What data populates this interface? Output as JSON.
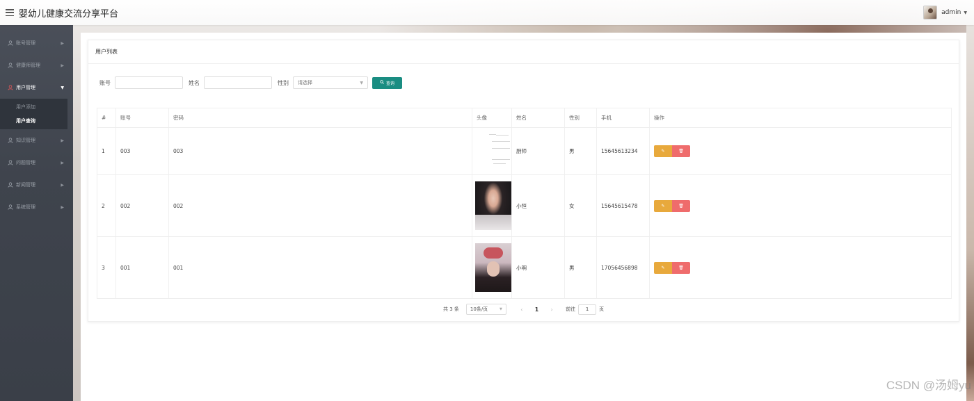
{
  "app": {
    "title": "婴幼儿健康交流分享平台"
  },
  "user": {
    "name": "admin"
  },
  "sidebar": {
    "items": [
      {
        "label": "账号管理"
      },
      {
        "label": "健康师管理"
      },
      {
        "label": "用户管理",
        "children": [
          {
            "label": "用户添加"
          },
          {
            "label": "用户查询"
          }
        ]
      },
      {
        "label": "知识管理"
      },
      {
        "label": "问题管理"
      },
      {
        "label": "新闻管理"
      },
      {
        "label": "系统管理"
      }
    ]
  },
  "card": {
    "title": "用户列表"
  },
  "filters": {
    "account_label": "账号",
    "name_label": "姓名",
    "gender_label": "性别",
    "gender_placeholder": "请选择",
    "query_button": "查询"
  },
  "table": {
    "headers": [
      "#",
      "账号",
      "密码",
      "头像",
      "姓名",
      "性别",
      "手机",
      "操作"
    ],
    "rows": [
      {
        "index": "1",
        "account": "003",
        "password": "003",
        "name": "厨师",
        "gender": "男",
        "phone": "15645613234"
      },
      {
        "index": "2",
        "account": "002",
        "password": "002",
        "name": "小恒",
        "gender": "女",
        "phone": "15645615478"
      },
      {
        "index": "3",
        "account": "001",
        "password": "001",
        "name": "小明",
        "gender": "男",
        "phone": "17056456898"
      }
    ]
  },
  "pagination": {
    "total": "共 3 条",
    "page_size": "10条/页",
    "current_page": "1",
    "goto_label": "前往",
    "goto_value": "1",
    "goto_suffix": "页"
  },
  "watermark": "CSDN @汤姆yu",
  "colors": {
    "primary": "#1a8d82",
    "edit": "#e8a93c",
    "delete": "#ef6c6c",
    "sidebar": "#3f444d"
  }
}
